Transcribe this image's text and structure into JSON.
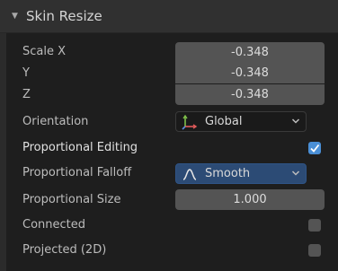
{
  "panel": {
    "title": "Skin Resize"
  },
  "scale": {
    "x_label": "Scale X",
    "x_value": "-0.348",
    "y_label": "Y",
    "y_value": "-0.348",
    "z_label": "Z",
    "z_value": "-0.348"
  },
  "orientation": {
    "label": "Orientation",
    "value": "Global"
  },
  "proportional_editing": {
    "label": "Proportional Editing",
    "checked": true
  },
  "proportional_falloff": {
    "label": "Proportional Falloff",
    "value": "Smooth"
  },
  "proportional_size": {
    "label": "Proportional Size",
    "value": "1.000"
  },
  "connected": {
    "label": "Connected",
    "checked": false
  },
  "projected": {
    "label": "Projected (2D)",
    "checked": false
  },
  "colors": {
    "accent": "#4a8fd6",
    "dropdown_active": "#2c4b75"
  }
}
